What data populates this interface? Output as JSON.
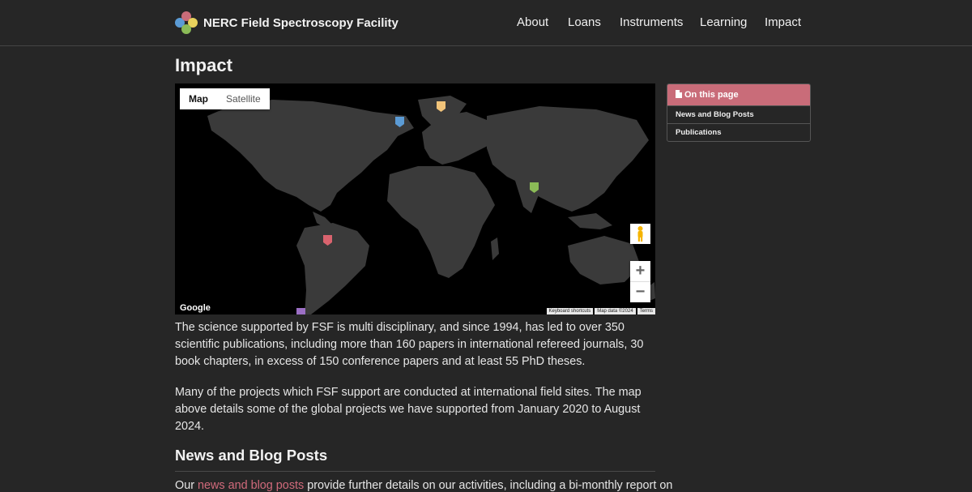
{
  "header": {
    "site_name": "NERC Field Spectroscopy Facility",
    "logo_colors": [
      "#c96c79",
      "#e8d15c",
      "#5b9bd5",
      "#8bbb57"
    ],
    "nav": [
      "About",
      "Loans",
      "Instruments",
      "Learning",
      "Impact"
    ]
  },
  "page": {
    "title": "Impact"
  },
  "map": {
    "type_buttons": [
      "Map",
      "Satellite"
    ],
    "active_type": "Map",
    "google_label": "Google",
    "attribution": [
      "Keyboard shortcuts",
      "Map data ©2024",
      "Terms"
    ],
    "zoom_in": "+",
    "zoom_out": "−",
    "marker_colors": [
      "#5b9bd5",
      "#f2c47a",
      "#8bbb57",
      "#d9636e",
      "#9b6fc4"
    ]
  },
  "content": {
    "para1": "The science supported by FSF is multi disciplinary, and since 1994, has led to over 350 scientific publications, including more than 160 papers in international refereed journals, 30 book chapters, in excess of 150 conference papers and at least 55 PhD theses.",
    "para2": "Many of the projects which FSF support are conducted at international field sites. The map above details some of the global projects we have supported from January 2020 to August 2024.",
    "news_heading": "News and Blog Posts",
    "cut_prefix": "Our ",
    "cut_link": "news and blog posts",
    "cut_suffix": " provide further details on our activities, including a bi-monthly report on"
  },
  "toc": {
    "title": "On this page",
    "items": [
      "News and Blog Posts",
      "Publications"
    ]
  }
}
